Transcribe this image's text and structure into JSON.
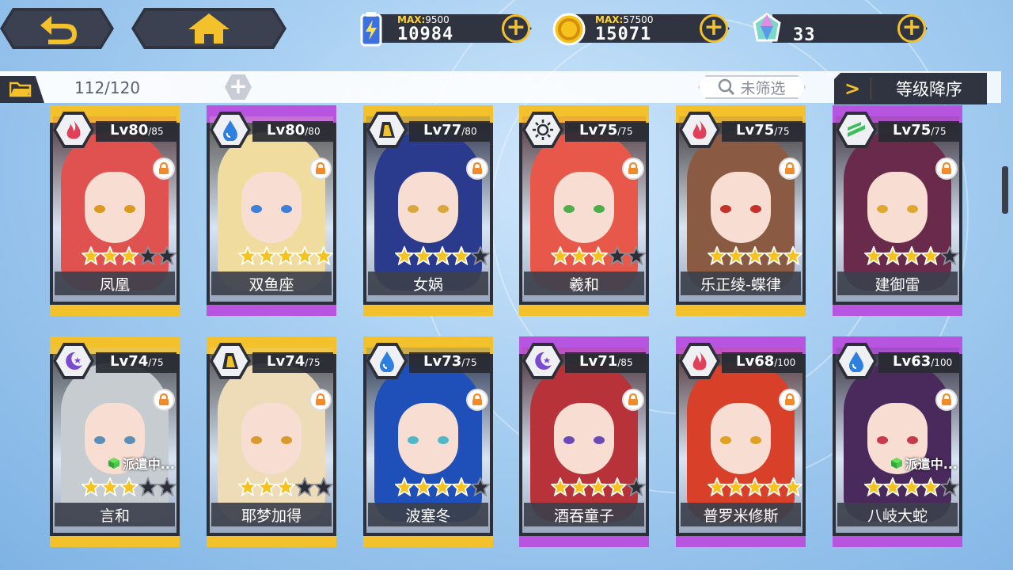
{
  "colors": {
    "gold": "#f2c12c",
    "purple": "#b855e0",
    "dark": "#2f3440"
  },
  "topbar": {
    "back_icon": "back-arrow-icon",
    "home_icon": "home-icon",
    "energy": {
      "max_label": "MAX:",
      "max_value": "9500",
      "value": "10984",
      "icon": "battery-icon"
    },
    "gold": {
      "max_label": "MAX:",
      "max_value": "57500",
      "value": "15071",
      "icon": "coin-icon"
    },
    "crystal": {
      "value": "33",
      "icon": "crystal-icon"
    },
    "plus_label": "+"
  },
  "subbar": {
    "count": "112/120",
    "add_label": "+",
    "filter_label": "未筛选",
    "sort_arrow": ">",
    "sort_label": "等级降序"
  },
  "cards": [
    {
      "name": "凤凰",
      "lv": "Lv80",
      "lvmax": "/85",
      "element": "fire",
      "rarity": "gold",
      "stars": 3,
      "dispatch": "",
      "hair": "#e0524f",
      "eye": "#d99a1e"
    },
    {
      "name": "双鱼座",
      "lv": "Lv80",
      "lvmax": "/80",
      "element": "water",
      "rarity": "purple",
      "stars": 5,
      "dispatch": "",
      "hair": "#f1dca0",
      "eye": "#3f7fd6"
    },
    {
      "name": "女娲",
      "lv": "Lv77",
      "lvmax": "/80",
      "element": "earth",
      "rarity": "gold",
      "stars": 4,
      "dispatch": "",
      "hair": "#2a3a8c",
      "eye": "#d8a83c"
    },
    {
      "name": "羲和",
      "lv": "Lv75",
      "lvmax": "/75",
      "element": "light",
      "rarity": "gold",
      "stars": 3,
      "dispatch": "",
      "hair": "#e8584a",
      "eye": "#4fae4a"
    },
    {
      "name": "乐正绫-蝶律",
      "lv": "Lv75",
      "lvmax": "/75",
      "element": "fire",
      "rarity": "gold",
      "stars": 5,
      "dispatch": "",
      "hair": "#8a5a42",
      "eye": "#c5322c"
    },
    {
      "name": "建御雷",
      "lv": "Lv75",
      "lvmax": "/75",
      "element": "wind",
      "rarity": "purple",
      "stars": 4,
      "dispatch": "",
      "hair": "#6a2a4c",
      "eye": "#e0a830"
    },
    {
      "name": "言和",
      "lv": "Lv74",
      "lvmax": "/75",
      "element": "dark",
      "rarity": "gold",
      "stars": 3,
      "dispatch": "派遣中...",
      "hair": "#c6ccd0",
      "eye": "#5c8fb8"
    },
    {
      "name": "耶梦加得",
      "lv": "Lv74",
      "lvmax": "/75",
      "element": "earth",
      "rarity": "gold",
      "stars": 3,
      "dispatch": "",
      "hair": "#eedcb8",
      "eye": "#d89a2a"
    },
    {
      "name": "波塞冬",
      "lv": "Lv73",
      "lvmax": "/75",
      "element": "water",
      "rarity": "gold",
      "stars": 4,
      "dispatch": "",
      "hair": "#1f4fb8",
      "eye": "#4fb8c8"
    },
    {
      "name": "酒吞童子",
      "lv": "Lv71",
      "lvmax": "/85",
      "element": "dark",
      "rarity": "purple",
      "stars": 4,
      "dispatch": "",
      "hair": "#b8323a",
      "eye": "#6a4ab8"
    },
    {
      "name": "普罗米修斯",
      "lv": "Lv68",
      "lvmax": "/100",
      "element": "fire",
      "rarity": "purple",
      "stars": 5,
      "dispatch": "",
      "hair": "#d8402a",
      "eye": "#e0a020"
    },
    {
      "name": "八岐大蛇",
      "lv": "Lv63",
      "lvmax": "/100",
      "element": "water",
      "rarity": "purple",
      "stars": 4,
      "dispatch": "派遣中...",
      "hair": "#4a2a5c",
      "eye": "#c83a4a"
    }
  ]
}
